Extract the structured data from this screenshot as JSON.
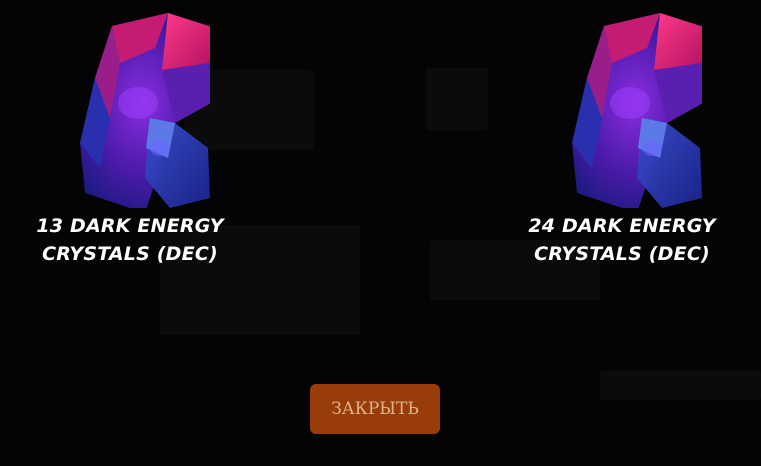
{
  "rewards": [
    {
      "label": "13 DARK ENERGY CRYSTALS (DEC)",
      "icon": "dark-energy-crystal-icon"
    },
    {
      "label": "24 DARK ENERGY CRYSTALS (DEC)",
      "icon": "dark-energy-crystal-icon"
    }
  ],
  "close_button": {
    "label": "ЗАКРЫТЬ",
    "color": "#983c0a",
    "text_color": "#e3b187"
  },
  "colors": {
    "background": "#040404",
    "label_text": "#ffffff"
  }
}
